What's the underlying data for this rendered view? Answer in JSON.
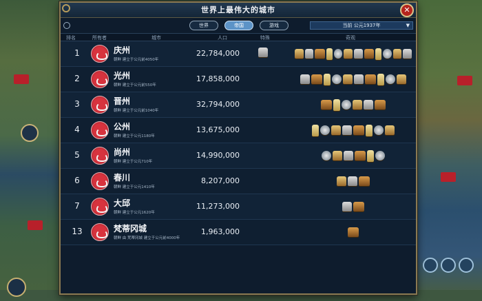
{
  "window": {
    "title": "世界上最伟大的城市",
    "close_label": "✕"
  },
  "tabs": [
    {
      "label": "世界",
      "active": false
    },
    {
      "label": "帝国",
      "active": true
    },
    {
      "label": "游戏",
      "active": false
    }
  ],
  "era_select": {
    "value": "当前 公元1937年"
  },
  "columns": {
    "rank": "排名",
    "owner": "所有者",
    "city": "城市",
    "population": "人口",
    "special": "特殊",
    "wonders": "奇观"
  },
  "cities": [
    {
      "rank": "1",
      "name": "庆州",
      "sub": "朝鲜 建立于公元前4050年",
      "population": "22,784,000",
      "wonder_count": 12,
      "has_special": true
    },
    {
      "rank": "2",
      "name": "光州",
      "sub": "朝鲜 建立于公元前550年",
      "population": "17,858,000",
      "wonder_count": 10,
      "has_special": false
    },
    {
      "rank": "3",
      "name": "晋州",
      "sub": "朝鲜 建立于公元前1040年",
      "population": "32,794,000",
      "wonder_count": 6,
      "has_special": false
    },
    {
      "rank": "4",
      "name": "公州",
      "sub": "朝鲜 建立于公元1180年",
      "population": "13,675,000",
      "wonder_count": 8,
      "has_special": false
    },
    {
      "rank": "5",
      "name": "尚州",
      "sub": "朝鲜 建立于公元710年",
      "population": "14,990,000",
      "wonder_count": 6,
      "has_special": false
    },
    {
      "rank": "6",
      "name": "春川",
      "sub": "朝鲜 建立于公元1410年",
      "population": "8,207,000",
      "wonder_count": 3,
      "has_special": false
    },
    {
      "rank": "7",
      "name": "大邱",
      "sub": "朝鲜 建立于公元1620年",
      "population": "11,273,000",
      "wonder_count": 2,
      "has_special": false
    },
    {
      "rank": "13",
      "name": "梵蒂冈城",
      "sub": "朝鲜 由 梵蒂冈城 建立于公元前4000年",
      "population": "1,963,000",
      "wonder_count": 1,
      "has_special": false
    }
  ],
  "colors": {
    "panel_bg": "#0e1c2d",
    "panel_border": "#8a7a52",
    "civ_red": "#d7333e",
    "tab_active": "#5c93c7"
  },
  "icons": {
    "close": "close-icon",
    "civ": "korea-civ-icon",
    "wonder": "wonder-icon"
  }
}
